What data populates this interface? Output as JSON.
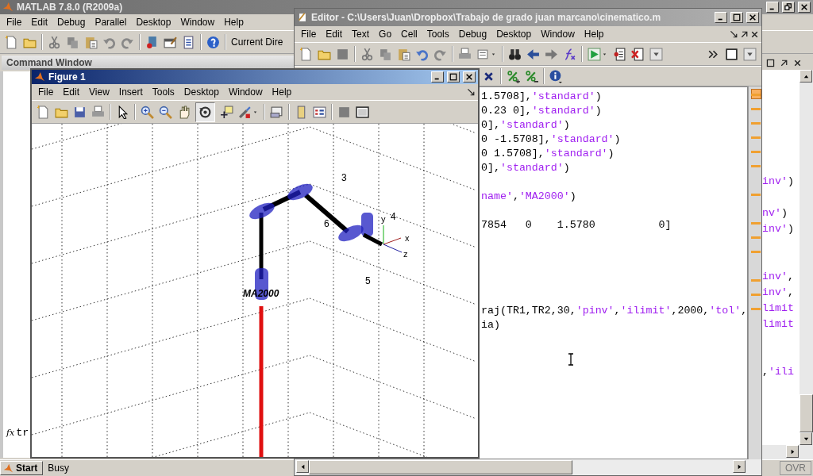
{
  "matlab": {
    "title": "MATLAB  7.8.0 (R2009a)",
    "menu": [
      "File",
      "Edit",
      "Debug",
      "Parallel",
      "Desktop",
      "Window",
      "Help"
    ],
    "current_directory_label": "Current Dire",
    "command_window": {
      "title": "Command Window",
      "prompt_icon": "fx",
      "command": "tr"
    },
    "side_code": [
      {
        "segments": [
          {
            "text": "inv'",
            "kind": "string"
          },
          {
            "text": ")",
            "kind": "code"
          }
        ]
      },
      {
        "segments": [
          {
            "text": "nv'",
            "kind": "string"
          },
          {
            "text": ")",
            "kind": "code"
          }
        ]
      },
      {
        "segments": [
          {
            "text": "inv'",
            "kind": "string"
          },
          {
            "text": ")",
            "kind": "code"
          }
        ]
      },
      {
        "segments": [
          {
            "text": "inv'",
            "kind": "string"
          },
          {
            "text": ",",
            "kind": "code"
          }
        ]
      },
      {
        "segments": [
          {
            "text": "inv'",
            "kind": "string"
          },
          {
            "text": ",",
            "kind": "code"
          }
        ]
      },
      {
        "segments": [
          {
            "text": "limit",
            "kind": "string"
          }
        ]
      },
      {
        "segments": [
          {
            "text": "limit",
            "kind": "string"
          }
        ]
      },
      {
        "segments": [
          {
            "text": ",",
            "kind": "code"
          },
          {
            "text": "'ili",
            "kind": "string"
          }
        ]
      }
    ],
    "status": {
      "start": "Start",
      "text": "Busy",
      "mode": "OVR"
    }
  },
  "editor": {
    "title": "Editor - C:\\Users\\Juan\\Dropbox\\Trabajo de grado  juan marcano\\cinematico.m",
    "menu": [
      "File",
      "Edit",
      "Text",
      "Go",
      "Cell",
      "Tools",
      "Debug",
      "Desktop",
      "Window",
      "Help"
    ],
    "code_lines": [
      {
        "segments": [
          {
            "text": "1.5708],",
            "kind": "code"
          },
          {
            "text": "'standard'",
            "kind": "string"
          },
          {
            "text": ")",
            "kind": "code"
          }
        ]
      },
      {
        "segments": [
          {
            "text": "0.23 0],",
            "kind": "code"
          },
          {
            "text": "'standard'",
            "kind": "string"
          },
          {
            "text": ")",
            "kind": "code"
          }
        ]
      },
      {
        "segments": [
          {
            "text": "0],",
            "kind": "code"
          },
          {
            "text": "'standard'",
            "kind": "string"
          },
          {
            "text": ")",
            "kind": "code"
          }
        ]
      },
      {
        "segments": [
          {
            "text": "0 -1.5708],",
            "kind": "code"
          },
          {
            "text": "'standard'",
            "kind": "string"
          },
          {
            "text": ")",
            "kind": "code"
          }
        ]
      },
      {
        "segments": [
          {
            "text": "0 1.5708],",
            "kind": "code"
          },
          {
            "text": "'standard'",
            "kind": "string"
          },
          {
            "text": ")",
            "kind": "code"
          }
        ]
      },
      {
        "segments": [
          {
            "text": "0],",
            "kind": "code"
          },
          {
            "text": "'standard'",
            "kind": "string"
          },
          {
            "text": ")",
            "kind": "code"
          }
        ]
      },
      {
        "segments": [
          {
            "text": "name'",
            "kind": "string"
          },
          {
            "text": ",",
            "kind": "code"
          },
          {
            "text": "'MA2000'",
            "kind": "string"
          },
          {
            "text": ")",
            "kind": "code"
          }
        ]
      },
      {
        "segments": [
          {
            "text": "7854   0    1.5780          0]",
            "kind": "code"
          }
        ]
      },
      {
        "segments": [
          {
            "text": "raj(TR1,TR2,30,",
            "kind": "code"
          },
          {
            "text": "'pinv'",
            "kind": "string"
          },
          {
            "text": ",",
            "kind": "code"
          },
          {
            "text": "'ilimit'",
            "kind": "string"
          },
          {
            "text": ",2000,",
            "kind": "code"
          },
          {
            "text": "'tol'",
            "kind": "string"
          },
          {
            "text": ",",
            "kind": "code"
          }
        ]
      },
      {
        "segments": [
          {
            "text": "ia)",
            "kind": "code"
          }
        ]
      }
    ]
  },
  "figure": {
    "title": "Figure 1",
    "menu": [
      "File",
      "Edit",
      "View",
      "Insert",
      "Tools",
      "Desktop",
      "Window",
      "Help"
    ],
    "rotate_tool_active": true,
    "robot_name": "MA2000",
    "joint_labels": [
      "3",
      "6",
      "4",
      "5"
    ],
    "axis_labels": [
      "x",
      "y",
      "z"
    ]
  }
}
